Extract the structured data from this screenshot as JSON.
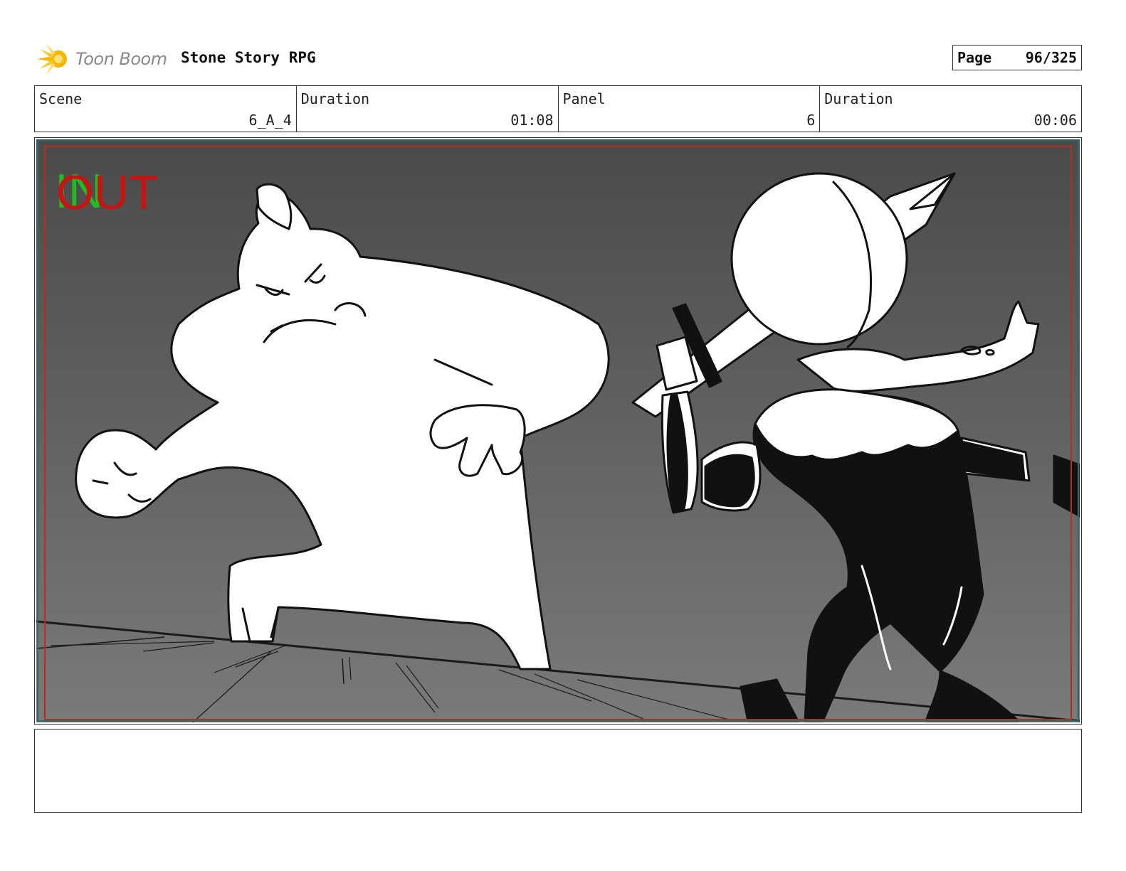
{
  "header": {
    "logo_text": "Toon Boom",
    "project_title": "Stone Story RPG",
    "page_label": "Page",
    "page_value": "96/325"
  },
  "info": {
    "scene_label": "Scene",
    "scene_value": "6_A_4",
    "duration_label": "Duration",
    "duration_value": "01:08",
    "panel_label": "Panel",
    "panel_value": "6",
    "panel_duration_label": "Duration",
    "panel_duration_value": "00:06"
  },
  "panel": {
    "in_marker": "IN",
    "out_marker": "OUT",
    "colors": {
      "in_marker": "#22bb22",
      "out_marker": "#cc1111",
      "safe_frame": "#b03020",
      "background_top": "#4a4a4a",
      "background_bottom": "#7a7a7a"
    }
  },
  "notes": {
    "text": ""
  }
}
